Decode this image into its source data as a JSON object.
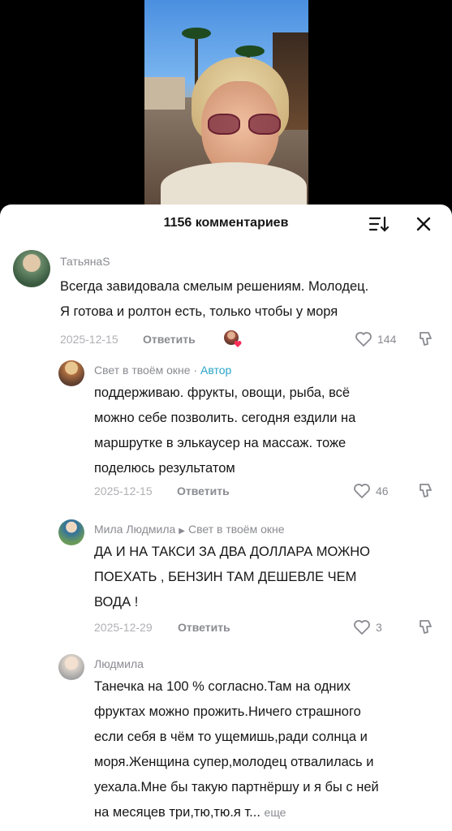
{
  "header": {
    "title": "1156 комментариев",
    "sort_icon": "sort-icon",
    "close_icon": "close-icon"
  },
  "comments": [
    {
      "author": "ТатьянаS",
      "text_lines": [
        "Всегда завидовала смелым решениям. Молодец.",
        "Я готова и ролтон есть, только чтобы у моря"
      ],
      "date": "2025-12-15",
      "reply_label": "Ответить",
      "likes": "144"
    },
    {
      "author": "Свет в твоём окне",
      "separator": " · ",
      "badge": "Автор",
      "text_lines": [
        "поддерживаю. фрукты, овощи, рыба, всё",
        "можно себе позволить. сегодня ездили на",
        "маршрутке в элькаусер на массаж. тоже",
        "поделюсь результатом"
      ],
      "date": "2025-12-15",
      "reply_label": "Ответить",
      "likes": "46"
    },
    {
      "author": "Мила Людмила",
      "reply_to": "Свет в твоём окне",
      "text_lines": [
        "ДА И НА ТАКСИ ЗА ДВА ДОЛЛАРА МОЖНО",
        "ПОЕХАТЬ , БЕНЗИН ТАМ ДЕШЕВЛЕ ЧЕМ",
        "ВОДА !"
      ],
      "date": "2025-12-29",
      "reply_label": "Ответить",
      "likes": "3"
    },
    {
      "author": "Людмила",
      "text_lines": [
        "Танечка на 100 % согласно.Там на одних",
        "фруктах можно прожить.Ничего страшного",
        "если себя в чём то ущемишь,ради солнца и",
        "моря.Женщина супер,молодец отвалилась и",
        "уехала.Мне бы такую партнёршу и я бы с ней",
        "на месяцев три,тю,тю.я т..."
      ],
      "more_label": "еще"
    }
  ],
  "colors": {
    "accent": "#2aa5c8",
    "muted": "#8a8b91",
    "date": "#b0b0b4",
    "heart": "#fe2c55"
  }
}
